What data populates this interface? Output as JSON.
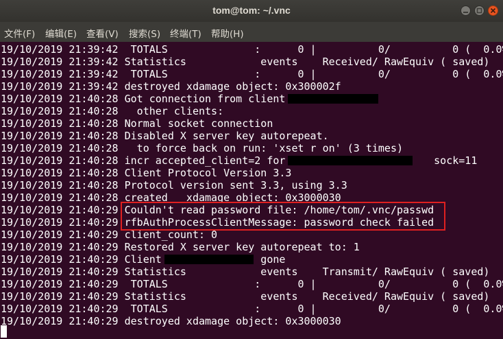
{
  "window": {
    "title": "tom@tom: ~/.vnc"
  },
  "menubar": {
    "items": [
      "文件(F)",
      "编辑(E)",
      "查看(V)",
      "搜索(S)",
      "终端(T)",
      "帮助(H)"
    ]
  },
  "terminal": {
    "lines": [
      "19/10/2019 21:39:42  TOTALS              :      0 |          0/          0 (  0.0%)",
      "19/10/2019 21:39:42 Statistics            events    Received/ RawEquiv ( saved)",
      "19/10/2019 21:39:42  TOTALS              :      0 |          0/          0 (  0.0%)",
      "19/10/2019 21:39:42 destroyed xdamage object: 0x300002f",
      "19/10/2019 21:40:28 Got connection from client",
      "19/10/2019 21:40:28   other clients:",
      "19/10/2019 21:40:28 Normal socket connection",
      "19/10/2019 21:40:28 Disabled X server key autorepeat.",
      "19/10/2019 21:40:28   to force back on run: 'xset r on' (3 times)",
      "19/10/2019 21:40:28 incr accepted_client=2 for                        sock=11",
      "19/10/2019 21:40:28 Client Protocol Version 3.3",
      "19/10/2019 21:40:28 Protocol version sent 3.3, using 3.3",
      "19/10/2019 21:40:28 created   xdamage object: 0x3000030",
      "19/10/2019 21:40:29 Couldn't read password file: /home/tom/.vnc/passwd",
      "19/10/2019 21:40:29 rfbAuthProcessClientMessage: password check failed",
      "19/10/2019 21:40:29 client_count: 0",
      "19/10/2019 21:40:29 Restored X server key autorepeat to: 1",
      "19/10/2019 21:40:29 Client                gone",
      "19/10/2019 21:40:29 Statistics            events    Transmit/ RawEquiv ( saved)",
      "19/10/2019 21:40:29  TOTALS              :      0 |          0/          0 (  0.0%)",
      "19/10/2019 21:40:29 Statistics            events    Received/ RawEquiv ( saved)",
      "19/10/2019 21:40:29  TOTALS              :      0 |          0/          0 (  0.0%)",
      "19/10/2019 21:40:29 destroyed xdamage object: 0x3000030"
    ]
  },
  "colors": {
    "terminal_bg": "#300a24",
    "highlight_border": "#e02020",
    "close_button": "#e95420"
  }
}
